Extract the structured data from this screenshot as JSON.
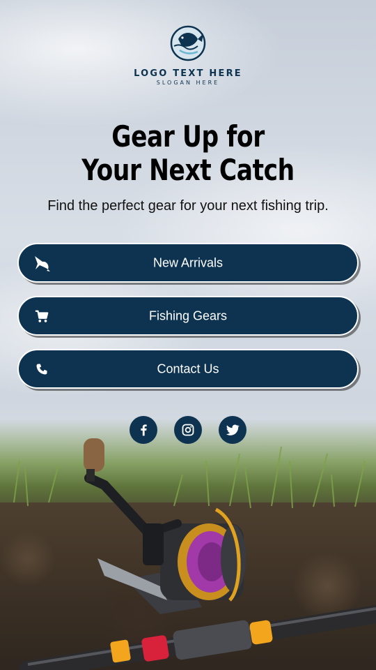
{
  "brand": {
    "logo_text": "LOGO TEXT HERE",
    "slogan": "SLOGAN HERE",
    "logo_icon": "leaping-fish-icon"
  },
  "hero": {
    "headline_line1": "Gear Up for",
    "headline_line2": "Your Next Catch",
    "subheadline": "Find the perfect gear for your next fishing trip."
  },
  "buttons": [
    {
      "label": "New Arrivals",
      "icon": "marlin-icon"
    },
    {
      "label": "Fishing Gears",
      "icon": "shopping-cart-icon"
    },
    {
      "label": "Contact Us",
      "icon": "phone-icon"
    }
  ],
  "social": [
    {
      "name": "facebook",
      "icon": "facebook-icon"
    },
    {
      "name": "instagram",
      "icon": "instagram-icon"
    },
    {
      "name": "twitter",
      "icon": "twitter-icon"
    }
  ],
  "colors": {
    "primary": "#0d3350",
    "button_text": "#ffffff",
    "headline": "#000000"
  }
}
